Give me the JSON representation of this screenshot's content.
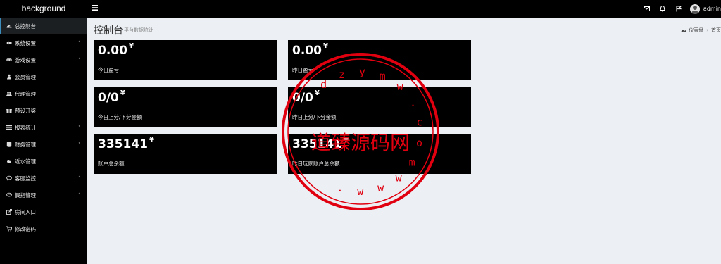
{
  "header": {
    "logo": "background",
    "menu_toggle_icon": "hamburger-icon",
    "icons": [
      "envelope-icon",
      "bell-icon",
      "flag-icon"
    ],
    "username": "admin"
  },
  "sidebar": {
    "items": [
      {
        "label": "总控制台",
        "icon": "dashboard-icon",
        "chevron": "",
        "active": true
      },
      {
        "label": "系统设置",
        "icon": "cogs-icon",
        "chevron": "‹"
      },
      {
        "label": "游戏设置",
        "icon": "gamepad-icon",
        "chevron": "‹"
      },
      {
        "label": "会员管理",
        "icon": "users-icon",
        "chevron": ""
      },
      {
        "label": "代理管理",
        "icon": "agents-icon",
        "chevron": ""
      },
      {
        "label": "预设开奖",
        "icon": "gift-icon",
        "chevron": ""
      },
      {
        "label": "报表统计",
        "icon": "list-icon",
        "chevron": "‹"
      },
      {
        "label": "财务管理",
        "icon": "database-icon",
        "chevron": "‹"
      },
      {
        "label": "返水管理",
        "icon": "cloud-icon",
        "chevron": ""
      },
      {
        "label": "客服监控",
        "icon": "comments-icon",
        "chevron": "‹"
      },
      {
        "label": "假指管理",
        "icon": "comment-icon",
        "chevron": "‹"
      },
      {
        "label": "房间入口",
        "icon": "external-link-icon",
        "chevron": ""
      },
      {
        "label": "修改密码",
        "icon": "cart-icon",
        "chevron": ""
      }
    ]
  },
  "page": {
    "title": "控制台",
    "subtitle": "平台数据统计",
    "breadcrumb": {
      "icon": "dashboard-icon",
      "first": "仪表盘",
      "second": "首页"
    }
  },
  "cards": [
    {
      "value": "0.00",
      "unit": "¥",
      "label": "今日盈亏"
    },
    {
      "value": "0.00",
      "unit": "¥",
      "label": "昨日盈亏"
    },
    {
      "value": "0/0",
      "unit": "¥",
      "label": "今日上分/下分金额"
    },
    {
      "value": "0/0",
      "unit": "¥",
      "label": "昨日上分/下分金额"
    },
    {
      "value": "335141",
      "unit": "¥",
      "label": "账户总余额"
    },
    {
      "value": "335141",
      "unit": "¥",
      "label": "昨日玩家账户总余额"
    }
  ],
  "watermark": {
    "center_text": "道臻源码网",
    "ring_top_letters": [
      "d",
      "z",
      "y",
      "m",
      "w",
      ".",
      "c",
      "o",
      "m",
      "w",
      "w",
      "w",
      "."
    ],
    "ring_bottom_letters": [
      "w",
      "w",
      "w",
      ".",
      "d",
      "z",
      "y",
      "m",
      "w",
      ".",
      "c",
      "o",
      "m"
    ],
    "color": "#e0000f"
  },
  "colors": {
    "topbar": "#000000",
    "sidebar": "#000000",
    "active_accent": "#3c8dbc",
    "content_bg": "#ecf0f5",
    "card_bg": "#000000"
  }
}
